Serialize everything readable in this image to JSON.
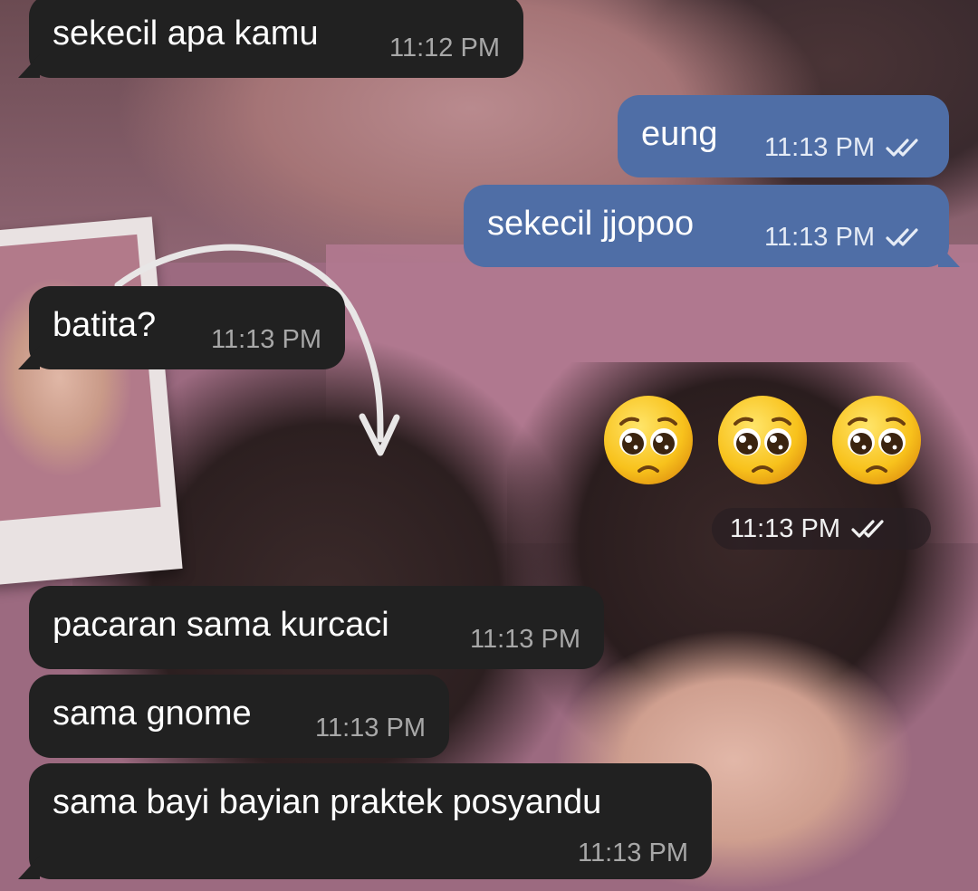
{
  "colors": {
    "incoming_bubble": "#212121",
    "outgoing_bubble": "#4f6ea6",
    "incoming_time": "#a8a8a8",
    "outgoing_time": "#e6ecf6"
  },
  "messages": [
    {
      "direction": "in",
      "text": "sekecil apa kamu",
      "time": "11:12 PM"
    },
    {
      "direction": "out",
      "text": "eung",
      "time": "11:13 PM",
      "status_icon": "double-check-icon"
    },
    {
      "direction": "out",
      "text": "sekecil jjopoo",
      "time": "11:13 PM",
      "status_icon": "double-check-icon"
    },
    {
      "direction": "in",
      "text": "batita?",
      "time": "11:13 PM"
    },
    {
      "direction": "out",
      "type": "emoji",
      "emoji": "🥺🥺🥺",
      "emoji_icon": "pleading-face-emoji",
      "time": "11:13 PM",
      "status_icon": "double-check-icon"
    },
    {
      "direction": "in",
      "text": "pacaran sama kurcaci",
      "time": "11:13 PM"
    },
    {
      "direction": "in",
      "text": "sama gnome",
      "time": "11:13 PM"
    },
    {
      "direction": "in",
      "text": "sama bayi bayian praktek posyandu",
      "time": "11:13 PM"
    }
  ]
}
